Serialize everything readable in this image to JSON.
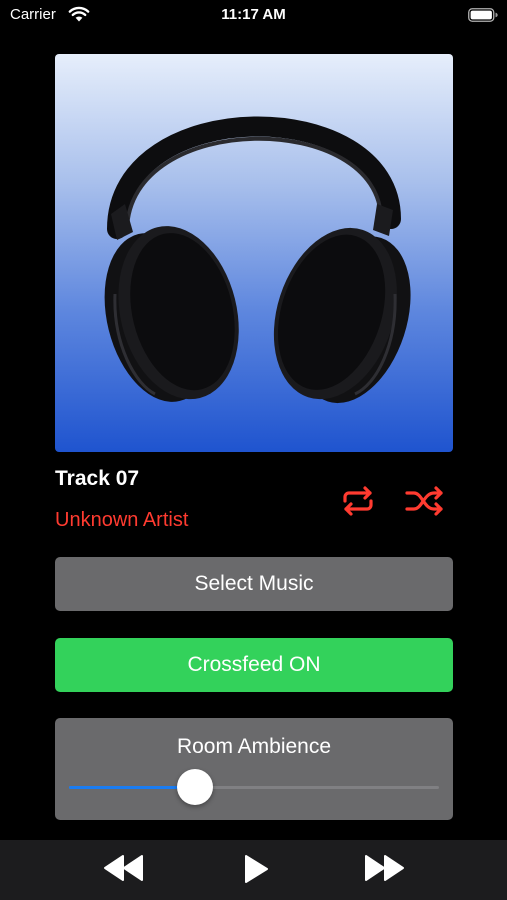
{
  "status_bar": {
    "carrier": "Carrier",
    "time": "11:17 AM",
    "wifi_icon": "wifi-icon",
    "battery_icon": "battery-icon"
  },
  "now_playing": {
    "artwork_icon": "headphones-artwork",
    "track_title": "Track 07",
    "artist": "Unknown Artist",
    "repeat_icon": "repeat-icon",
    "shuffle_icon": "shuffle-icon",
    "accent_color": "#ff3b30"
  },
  "buttons": {
    "select_music": "Select Music",
    "crossfeed": "Crossfeed ON",
    "crossfeed_color": "#33d25b"
  },
  "ambience": {
    "label": "Room Ambience",
    "value": 0.34,
    "fill_color": "#1a7cf2"
  },
  "toolbar": {
    "rewind_icon": "rewind-icon",
    "play_icon": "play-icon",
    "fast_forward_icon": "fast-forward-icon"
  }
}
